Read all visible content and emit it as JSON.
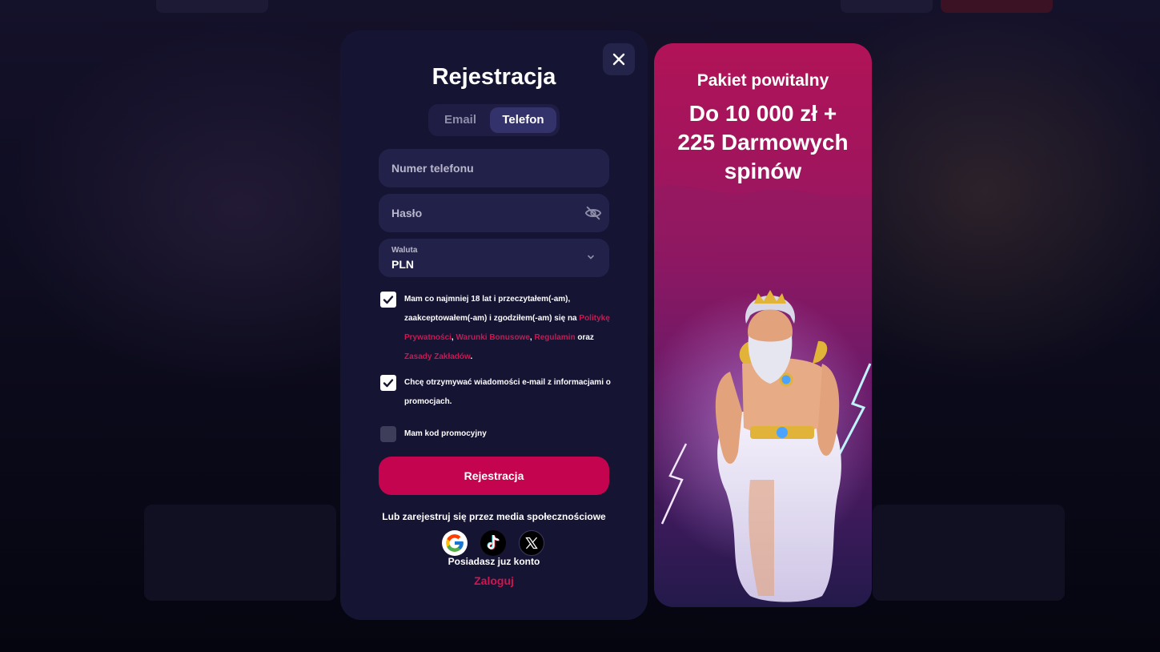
{
  "modal": {
    "title": "Rejestracja",
    "tabs": [
      {
        "label": "Email",
        "active": false
      },
      {
        "label": "Telefon",
        "active": true
      }
    ],
    "phone_field": {
      "placeholder": "Numer telefonu"
    },
    "password_field": {
      "placeholder": "Hasło"
    },
    "currency": {
      "label": "Waluta",
      "value": "PLN"
    },
    "terms": {
      "checked": true,
      "text_1": "Mam co najmniej 18 lat i przeczytałem(-am), zaakceptowałem(-am) i zgodziłem(-am) się na",
      "link_privacy": "Politykę Prywatności",
      "sep_1": ",",
      "link_bonus": "Warunki Bonusowe",
      "sep_2": ",",
      "link_rules": "Regulamin",
      "and": "oraz",
      "link_betting": "Zasady Zakładów",
      "end": "."
    },
    "newsletter": {
      "checked": true,
      "text": "Chcę otrzymywać wiadomości e-mail z informacjami o promocjach."
    },
    "promo_code": {
      "checked": false,
      "text": "Mam kod promocyjny"
    },
    "submit_label": "Rejestracja",
    "social_text": "Lub zarejestruj się przez media społecznościowe",
    "social_icons": [
      "google-icon",
      "tiktok-icon",
      "x-icon"
    ],
    "have_account": "Posiadasz juz konto",
    "login_link": "Zaloguj"
  },
  "promo": {
    "heading": "Pakiet powitalny",
    "offer_line_1": "Do 10 000 zł +",
    "offer_line_2": "225 Darmowych",
    "offer_line_3": "spinów"
  },
  "colors": {
    "accent": "#c4044e",
    "link": "#d1164f",
    "modal_bg": "#151433",
    "field_bg": "#22214a"
  }
}
